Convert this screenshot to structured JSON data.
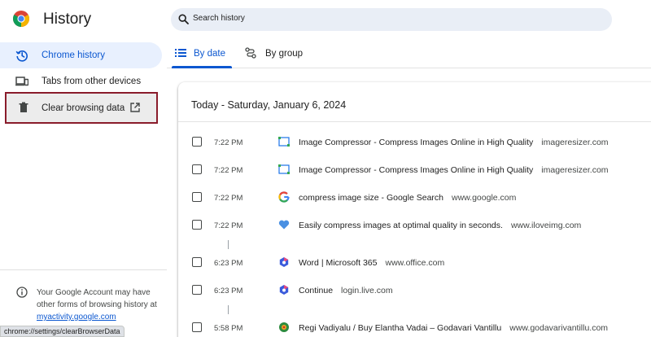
{
  "app": {
    "title": "History"
  },
  "search": {
    "placeholder": "Search history"
  },
  "sidebar": {
    "items": [
      {
        "label": "Chrome history",
        "icon": "history-icon",
        "active": true
      },
      {
        "label": "Tabs from other devices",
        "icon": "devices-icon",
        "active": false
      },
      {
        "label": "Clear browsing data",
        "icon": "trash-icon",
        "active": false
      }
    ],
    "info": {
      "text": "Your Google Account may have other forms of browsing history at",
      "link": "myactivity.google.com"
    }
  },
  "tabs": [
    {
      "label": "By date",
      "icon": "list-icon",
      "selected": true
    },
    {
      "label": "By group",
      "icon": "group-icon",
      "selected": false
    }
  ],
  "history": {
    "heading": "Today - Saturday, January 6, 2024",
    "entries": [
      {
        "time": "7:22 PM",
        "title": "Image Compressor - Compress Images Online in High Quality",
        "domain": "imageresizer.com",
        "favicon": "imageresizer-favicon"
      },
      {
        "time": "7:22 PM",
        "title": "Image Compressor - Compress Images Online in High Quality",
        "domain": "imageresizer.com",
        "favicon": "imageresizer-favicon"
      },
      {
        "time": "7:22 PM",
        "title": "compress image size - Google Search",
        "domain": "www.google.com",
        "favicon": "google-favicon"
      },
      {
        "time": "7:22 PM",
        "title": "Easily compress images at optimal quality in seconds.",
        "domain": "www.iloveimg.com",
        "favicon": "iloveimg-favicon"
      },
      {
        "time": "6:23 PM",
        "title": "Word | Microsoft 365",
        "domain": "www.office.com",
        "favicon": "microsoft-favicon"
      },
      {
        "time": "6:23 PM",
        "title": "Continue",
        "domain": "login.live.com",
        "favicon": "microsoft-favicon"
      },
      {
        "time": "5:58 PM",
        "title": "Regi Vadiyalu / Buy Elantha Vadai – Godavari Vantillu",
        "domain": "www.godavarivantillu.com",
        "favicon": "godavari-favicon"
      }
    ]
  },
  "status_bar": {
    "url": "chrome://settings/clearBrowserData"
  },
  "colors": {
    "accent": "#0b57d0",
    "active_bg": "#e8f0fe",
    "highlight_border": "#8a1c2b"
  }
}
